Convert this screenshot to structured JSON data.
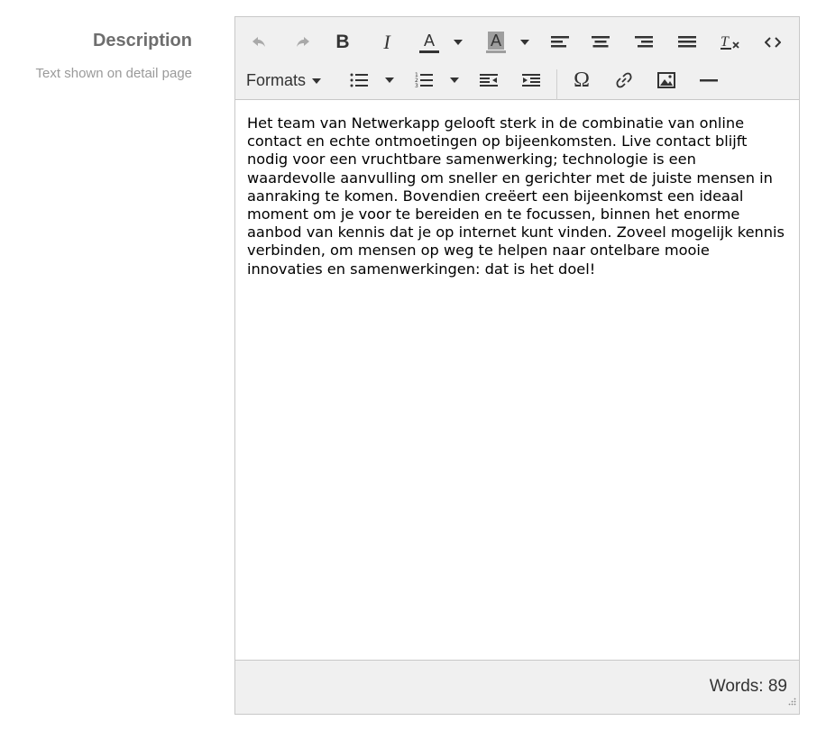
{
  "field": {
    "label": "Description",
    "help": "Text shown on detail page"
  },
  "toolbar": {
    "formats_label": "Formats",
    "bold_label": "B",
    "italic_label": "I",
    "text_color_label": "A",
    "bg_color_label": "A",
    "special_char_label": "Ω",
    "text_color": "#333333",
    "bg_color": "#9e9e9e"
  },
  "content": {
    "text": "Het team van Netwerkapp gelooft sterk in de combinatie van online contact en echte ontmoetingen op bijeenkomsten. Live contact blijft nodig voor een vruchtbare samenwerking; technologie is een waardevolle aanvulling om sneller en gerichter met de juiste mensen in aanraking te komen. Bovendien creëert een bijeenkomst een ideaal moment om je voor te bereiden en te focussen, binnen het enorme aanbod van kennis dat je op internet kunt vinden. Zoveel mogelijk kennis verbinden, om mensen op weg te helpen naar ontelbare mooie innovaties en samenwerkingen: dat is het doel!"
  },
  "status": {
    "word_count": "Words: 89"
  }
}
